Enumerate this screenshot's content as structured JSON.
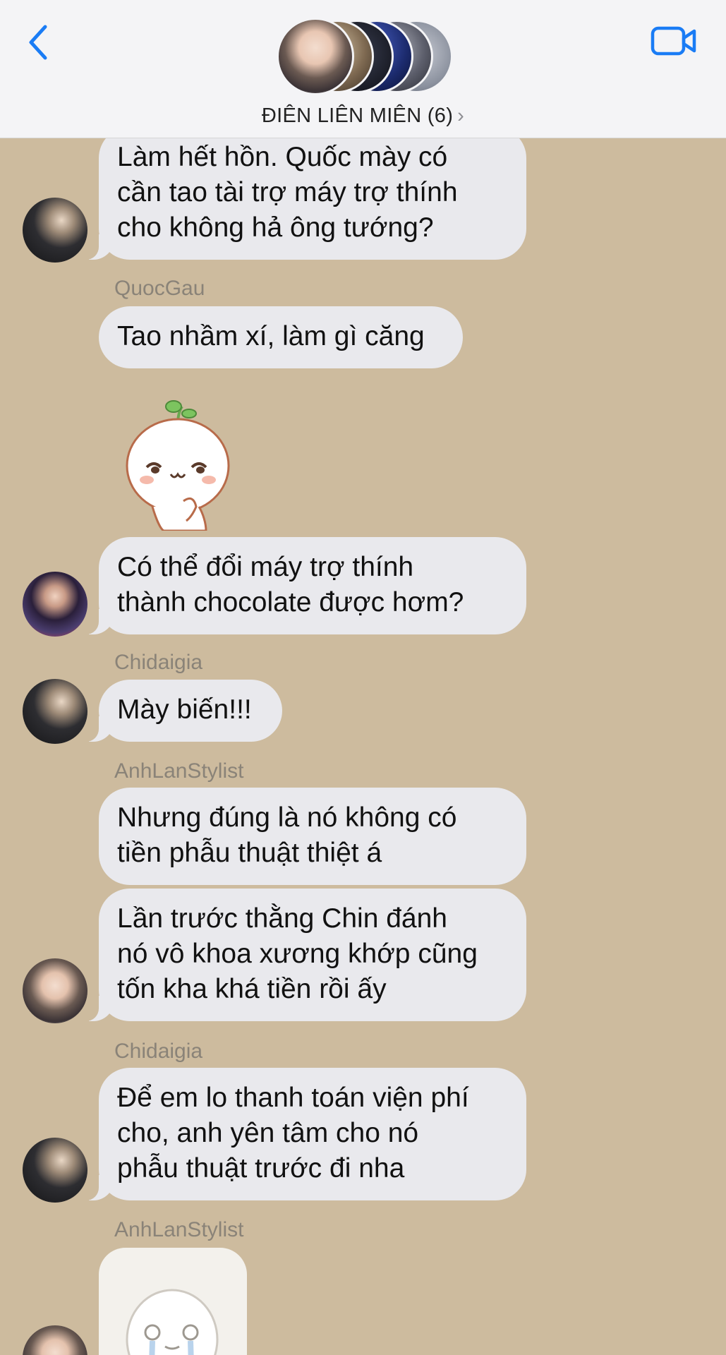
{
  "header": {
    "title": "ĐIÊN LIÊN MIÊN (6)",
    "chevron": "›",
    "back_icon": "chevron-left-icon",
    "video_icon": "video-camera-icon",
    "accent_color": "#1a7cf5"
  },
  "chat": {
    "background_color": "#cdbb9e",
    "bubble_color": "#e9e9ed",
    "messages": [
      {
        "text": "Làm hết hồn. Quốc mày có\ncần tao tài trợ máy trợ thính\ncho không hả ông tướng?"
      },
      {
        "sender": "QuocGau",
        "text": "Tao nhầm xí, làm gì căng"
      },
      {
        "sticker": "blushing-egg-sticker"
      },
      {
        "text": "Có thể đổi máy trợ thính\nthành chocolate được hơm?"
      },
      {
        "sender": "Chidaigia",
        "text": "Mày biến!!!"
      },
      {
        "sender": "AnhLanStylist",
        "text": "Nhưng đúng là nó không có\ntiền phẫu thuật thiệt á"
      },
      {
        "text": "Lần trước thằng Chin đánh\nnó vô khoa xương khớp cũng\ntốn kha khá tiền rồi ấy"
      },
      {
        "sender": "Chidaigia",
        "text": "Để em lo thanh toán viện phí\ncho, anh yên tâm cho nó\nphẫu thuật trước đi nha"
      },
      {
        "sender": "AnhLanStylist",
        "sticker": "crying-sticker"
      }
    ]
  }
}
